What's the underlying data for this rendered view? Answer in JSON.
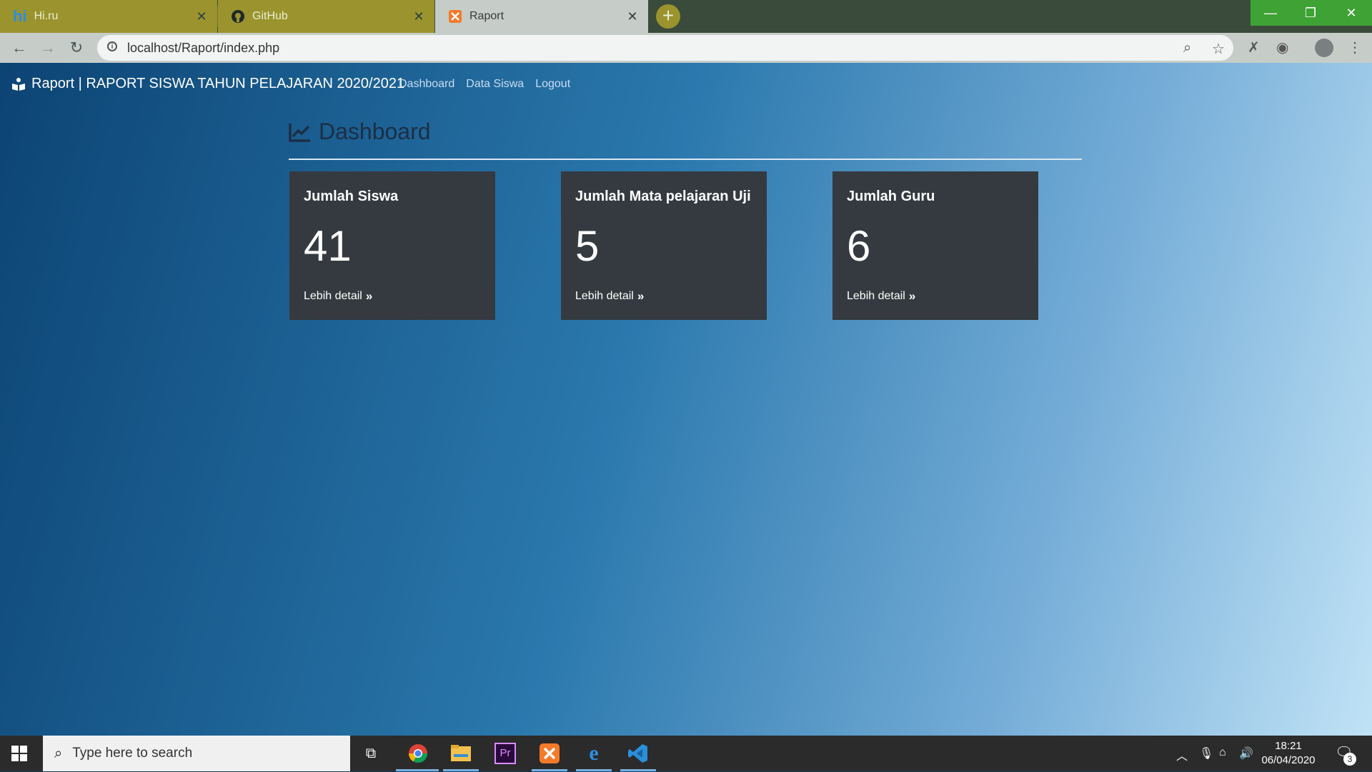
{
  "browser": {
    "tabs": [
      {
        "title": "Hi.ru",
        "icon": "hi-icon",
        "active": false
      },
      {
        "title": "GitHub",
        "icon": "github-icon",
        "active": false
      },
      {
        "title": "Raport",
        "icon": "xampp-icon",
        "active": true
      }
    ],
    "url": "localhost/Raport/index.php",
    "colors": {
      "tabstrip": "#3b4b3b",
      "inactive_tab": "#9a932e",
      "toolbar": "#c6cdc9",
      "window_controls": "#3fa234"
    }
  },
  "navbar": {
    "brand": "Raport | RAPORT SISWA TAHUN PELAJARAN 2020/2021",
    "links": [
      "Dashboard",
      "Data Siswa",
      "Logout"
    ]
  },
  "dashboard": {
    "heading": "Dashboard",
    "cards": [
      {
        "title": "Jumlah Siswa",
        "value": "41",
        "link": "Lebih detail"
      },
      {
        "title": "Jumlah Mata pelajaran Uji",
        "value": "5",
        "link": "Lebih detail"
      },
      {
        "title": "Jumlah Guru",
        "value": "6",
        "link": "Lebih detail"
      }
    ],
    "colors": {
      "card_bg": "#343a40",
      "heading": "#1c2e45",
      "gradient_start": "#0c4474",
      "gradient_end": "#c0e2f6"
    }
  },
  "taskbar": {
    "search_placeholder": "Type here to search",
    "apps": [
      "chrome-icon",
      "file-explorer-icon",
      "premiere-icon",
      "xampp-icon",
      "edge-icon",
      "vscode-icon"
    ],
    "time": "18:21",
    "date": "06/04/2020",
    "notification_count": "3"
  }
}
